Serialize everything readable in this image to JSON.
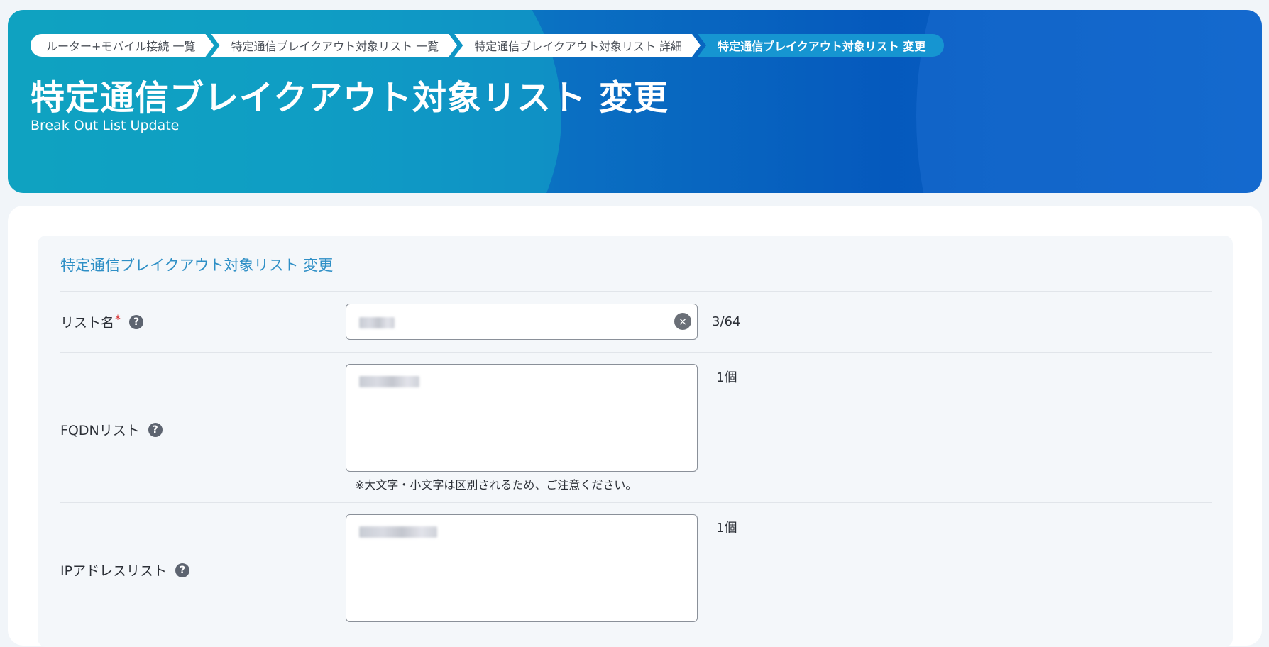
{
  "breadcrumb": [
    {
      "label": "ルーター+モバイル接続 一覧"
    },
    {
      "label": "特定通信ブレイクアウト対象リスト 一覧"
    },
    {
      "label": "特定通信ブレイクアウト対象リスト 詳細"
    },
    {
      "label": "特定通信ブレイクアウト対象リスト 変更"
    }
  ],
  "header": {
    "title": "特定通信ブレイクアウト対象リスト 変更",
    "subtitle": "Break Out List Update"
  },
  "form": {
    "section_title": "特定通信ブレイクアウト対象リスト 変更",
    "list_name": {
      "label": "リスト名",
      "required_mark": "*",
      "help_icon": "?",
      "clear_icon": "×",
      "counter": "3/64"
    },
    "fqdn_list": {
      "label": "FQDNリスト",
      "help_icon": "?",
      "count": "1個",
      "note": "※大文字・小文字は区別されるため、ご注意ください。"
    },
    "ip_list": {
      "label": "IPアドレスリスト",
      "help_icon": "?",
      "count": "1個"
    }
  },
  "colors": {
    "accent": "#2e8fc6",
    "breadcrumb_active": "#1695d1",
    "required": "#d93030"
  }
}
